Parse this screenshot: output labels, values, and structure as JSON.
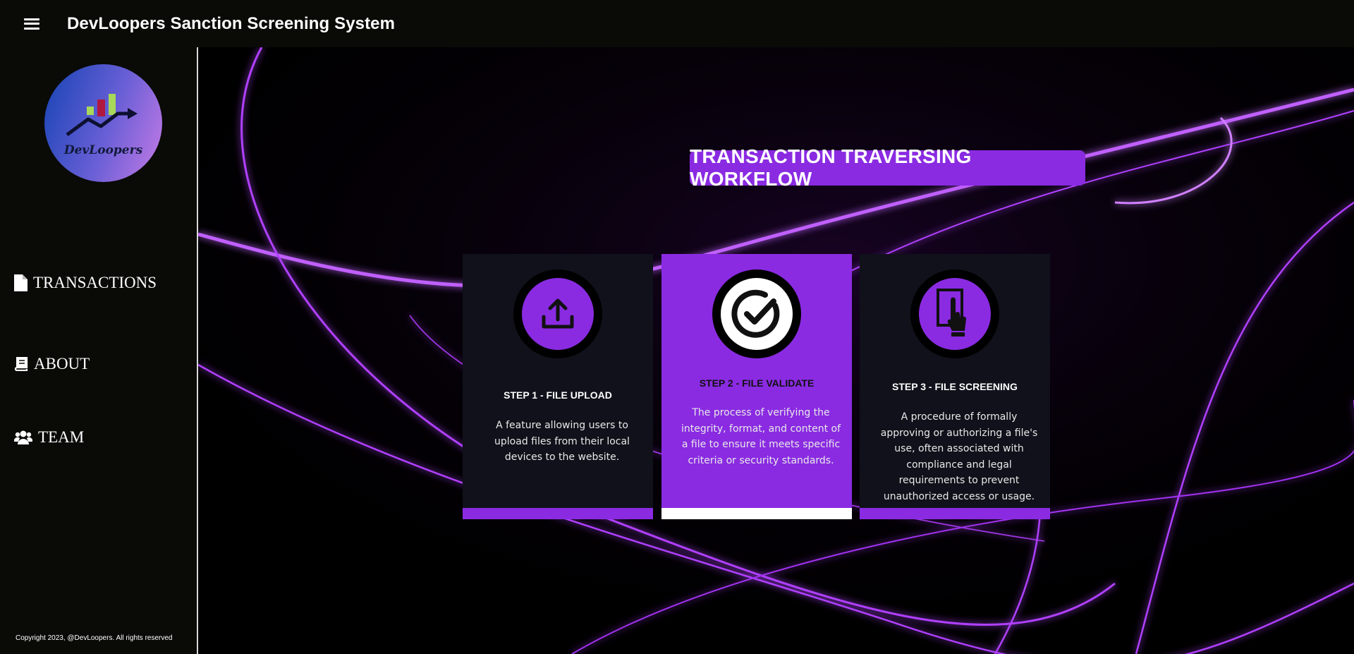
{
  "header": {
    "menu_icon": "hamburger-menu-icon",
    "title": "DevLoopers Sanction Screening System"
  },
  "sidebar": {
    "logo_text": "DevLoopers",
    "nav": [
      {
        "label": "TRANSACTIONS",
        "icon": "file-icon"
      },
      {
        "label": "ABOUT",
        "icon": "book-icon"
      },
      {
        "label": "TEAM",
        "icon": "users-icon"
      }
    ],
    "footer": "Copyright 2023, @DevLoopers. All rights reserved"
  },
  "main": {
    "heading": "TRANSACTION TRAVERSING WORKFLOW",
    "steps": [
      {
        "title": "STEP 1 - FILE UPLOAD",
        "description": "A feature allowing users to upload files from their local devices to the website.",
        "icon": "upload-icon"
      },
      {
        "title": "STEP 2 - FILE VALIDATE",
        "description": "The process of verifying the integrity, format, and content of a file to ensure it meets specific criteria or security standards.",
        "icon": "check-circle-icon"
      },
      {
        "title": "STEP 3 - FILE SCREENING",
        "description": "A procedure of formally approving or authorizing a file's use, often associated with compliance and legal requirements to prevent unauthorized access or usage.",
        "icon": "tap-screen-icon"
      }
    ]
  },
  "colors": {
    "accent": "#8a2be2",
    "topbar": "#0a0a06",
    "card": "#10111a"
  }
}
